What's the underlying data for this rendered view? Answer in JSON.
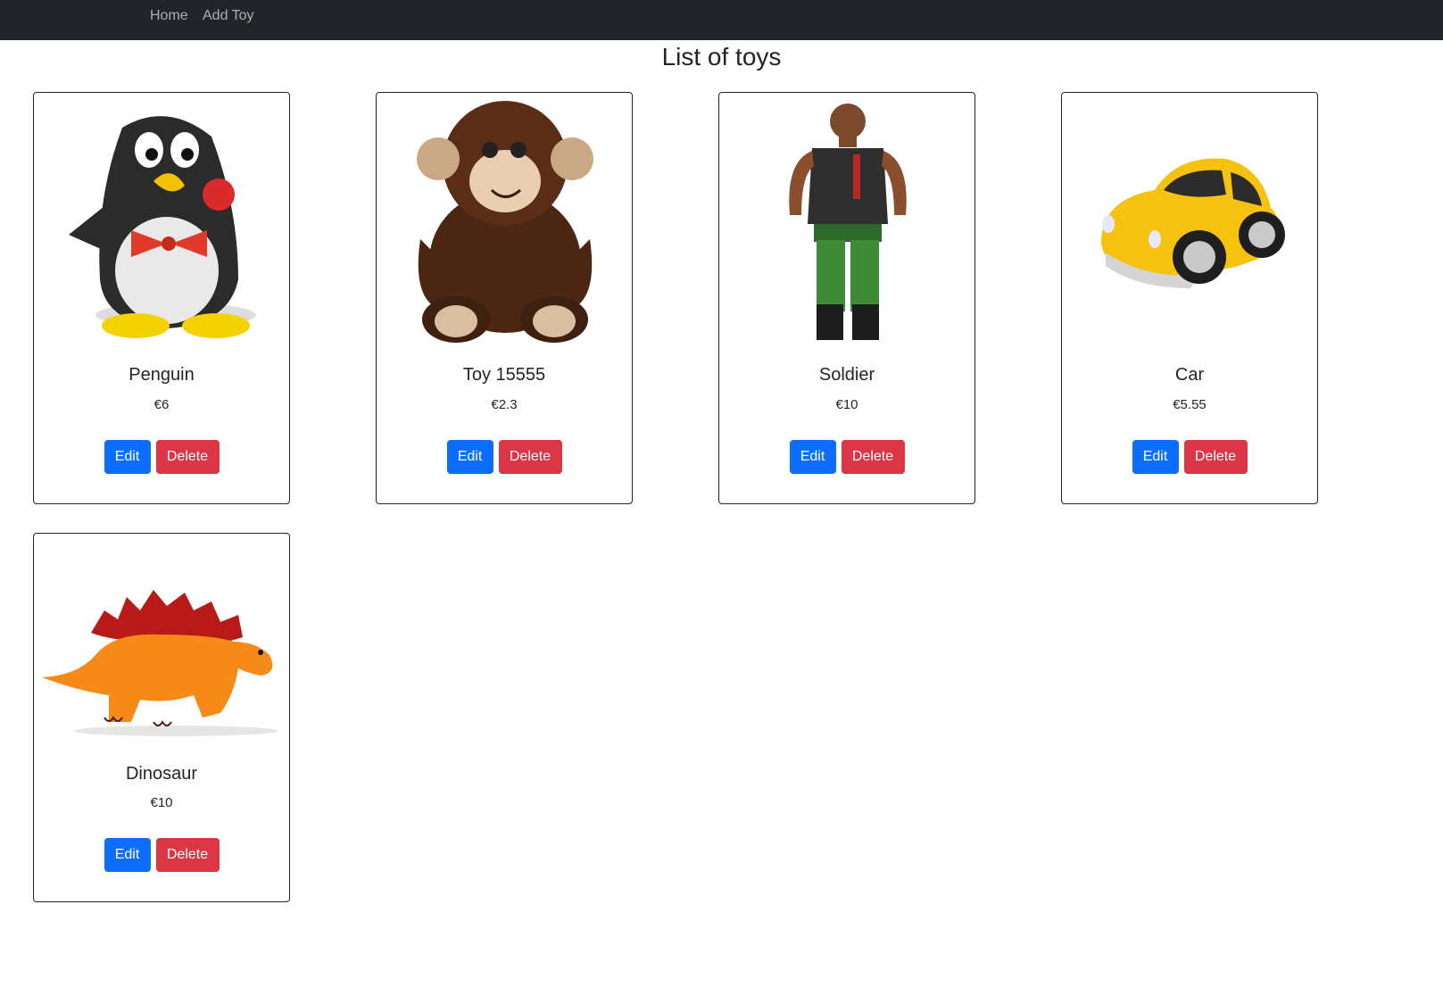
{
  "nav": {
    "home_label": "Home",
    "add_toy_label": "Add Toy"
  },
  "page": {
    "title": "List of toys"
  },
  "toys": [
    {
      "name": "Penguin",
      "price": "€6",
      "image": "penguin-image",
      "edit_label": "Edit",
      "delete_label": "Delete"
    },
    {
      "name": "Toy 15555",
      "price": "€2.3",
      "image": "monkey-plush-image",
      "edit_label": "Edit",
      "delete_label": "Delete"
    },
    {
      "name": "Soldier",
      "price": "€10",
      "image": "soldier-figure-image",
      "edit_label": "Edit",
      "delete_label": "Delete"
    },
    {
      "name": "Car",
      "price": "€5.55",
      "image": "toy-car-image",
      "edit_label": "Edit",
      "delete_label": "Delete"
    },
    {
      "name": "Dinosaur",
      "price": "€10",
      "image": "dinosaur-image",
      "edit_label": "Edit",
      "delete_label": "Delete"
    }
  ],
  "colors": {
    "navbar": "#212529",
    "edit_button": "#0d6efd",
    "delete_button": "#dc3545"
  }
}
